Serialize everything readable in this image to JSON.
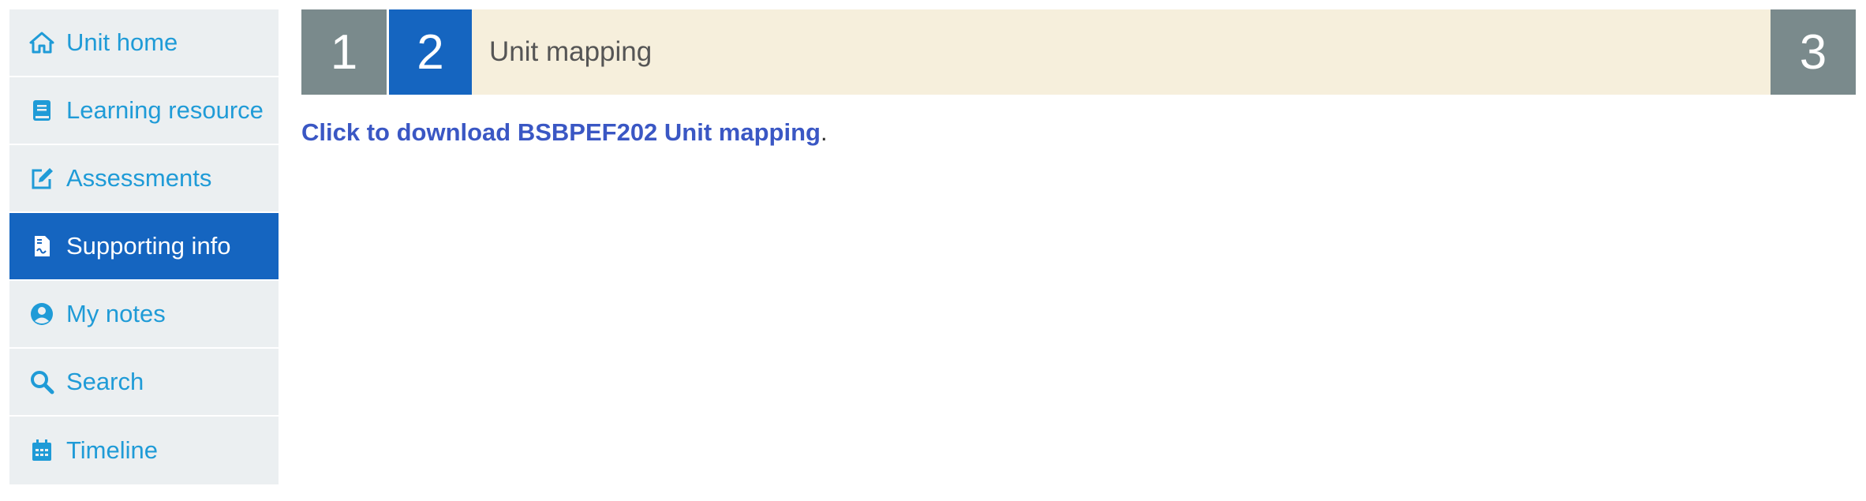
{
  "sidebar": {
    "items": [
      {
        "label": "Unit home",
        "icon": "home-icon",
        "active": false
      },
      {
        "label": "Learning resource",
        "icon": "book-icon",
        "active": false
      },
      {
        "label": "Assessments",
        "icon": "edit-icon",
        "active": false
      },
      {
        "label": "Supporting info",
        "icon": "file-signature-icon",
        "active": true
      },
      {
        "label": "My notes",
        "icon": "user-circle-icon",
        "active": false
      },
      {
        "label": "Search",
        "icon": "search-icon",
        "active": false
      },
      {
        "label": "Timeline",
        "icon": "calendar-icon",
        "active": false
      }
    ]
  },
  "steps": {
    "step1": "1",
    "step2": "2",
    "title": "Unit mapping",
    "step3": "3"
  },
  "content": {
    "link_text": "Click to download BSBPEF202 Unit mapping",
    "suffix": "."
  },
  "colors": {
    "accent": "#1565c0",
    "link": "#1f9bd7",
    "sidebar_bg": "#ebeff1",
    "header_bg": "#f6efdc",
    "step_grey": "#7a8a8c"
  }
}
